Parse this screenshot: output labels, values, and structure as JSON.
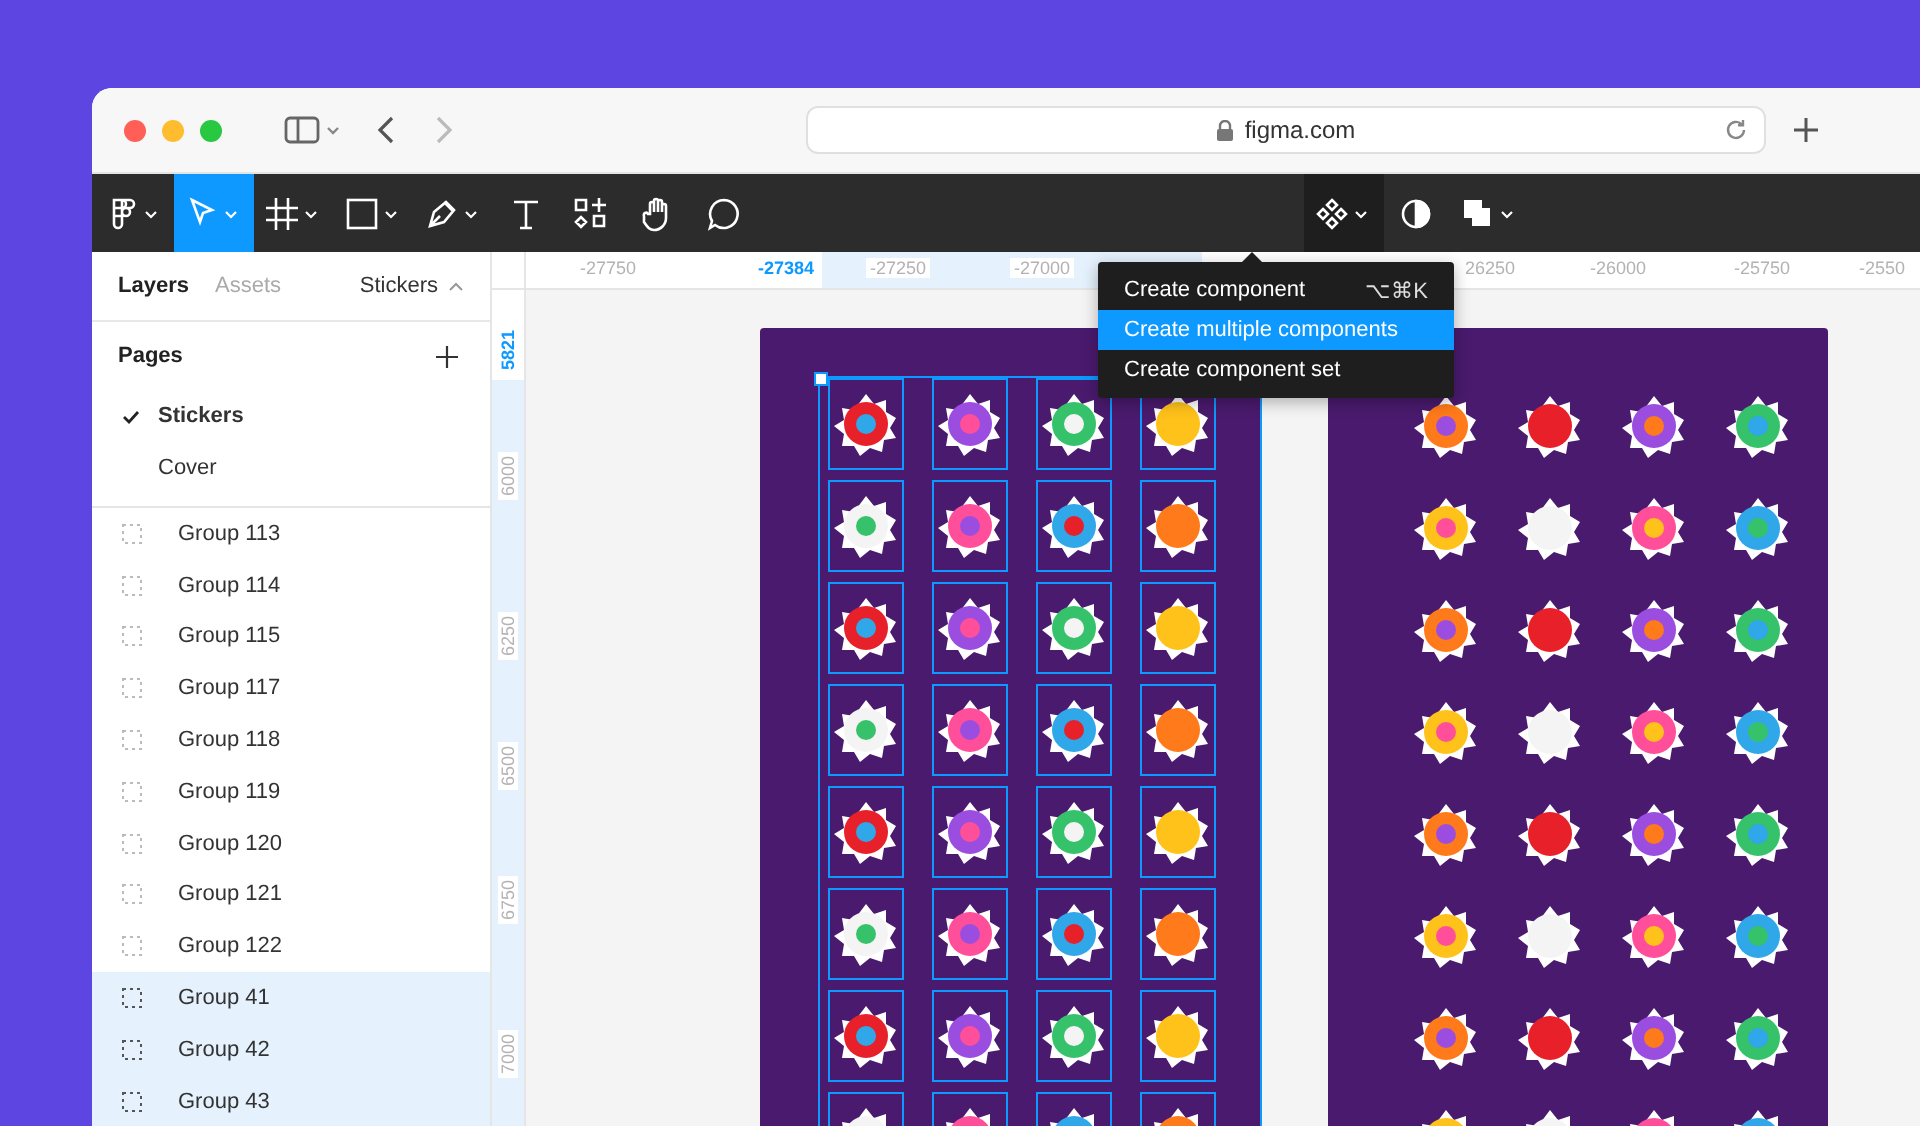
{
  "browser": {
    "url": "figma.com"
  },
  "toolbar": {
    "left_tools": [
      {
        "selected": false
      },
      {
        "selected": true
      },
      {
        "selected": false
      },
      {
        "selected": false
      },
      {
        "selected": false
      },
      {
        "selected": false
      },
      {
        "selected": false
      },
      {
        "selected": false
      },
      {
        "selected": false
      }
    ],
    "right_tools": [
      {
        "menu_open": true
      },
      {
        "menu_open": false
      },
      {
        "menu_open": false
      }
    ]
  },
  "menu": [
    {
      "label": "Create component",
      "shortcut": "⌥⌘K",
      "selected": false
    },
    {
      "label": "Create multiple components",
      "selected": true
    },
    {
      "label": "Create component set",
      "selected": false
    }
  ],
  "panel": {
    "tabs": [
      {
        "label": "Layers",
        "selected": true
      },
      {
        "label": "Assets",
        "selected": false
      }
    ],
    "page_picker": "Stickers",
    "pages": {
      "title": "Pages",
      "items": [
        {
          "label": "Stickers",
          "selected": true
        },
        {
          "label": "Cover",
          "selected": false
        }
      ]
    },
    "layers": [
      {
        "label": "Group 113",
        "selected": false
      },
      {
        "label": "Group 114",
        "selected": false
      },
      {
        "label": "Group 115",
        "selected": false
      },
      {
        "label": "Group 117",
        "selected": false
      },
      {
        "label": "Group 118",
        "selected": false
      },
      {
        "label": "Group 119",
        "selected": false
      },
      {
        "label": "Group 120",
        "selected": false
      },
      {
        "label": "Group 121",
        "selected": false
      },
      {
        "label": "Group 122",
        "selected": false
      },
      {
        "label": "Group 41",
        "selected": true
      },
      {
        "label": "Group 42",
        "selected": true
      },
      {
        "label": "Group 43",
        "selected": true
      }
    ]
  },
  "rulers": {
    "horizontal": [
      {
        "label": "-27750",
        "selected": false
      },
      {
        "label": "-27384",
        "selected": true
      },
      {
        "label": "-27250",
        "selected": false
      },
      {
        "label": "-27000",
        "selected": false
      },
      {
        "label": "26250",
        "selected": false
      },
      {
        "label": "-26000",
        "selected": false
      },
      {
        "label": "-25750",
        "selected": false
      },
      {
        "label": "-2550",
        "selected": false
      }
    ],
    "vertical": [
      {
        "label": "5821",
        "selected": true
      },
      {
        "label": "6000",
        "selected": false
      },
      {
        "label": "6250",
        "selected": false
      },
      {
        "label": "6500",
        "selected": false
      },
      {
        "label": "6750",
        "selected": false
      },
      {
        "label": "7000",
        "selected": false
      }
    ]
  },
  "frames": [
    {
      "selected": true
    },
    {
      "selected": false
    }
  ]
}
